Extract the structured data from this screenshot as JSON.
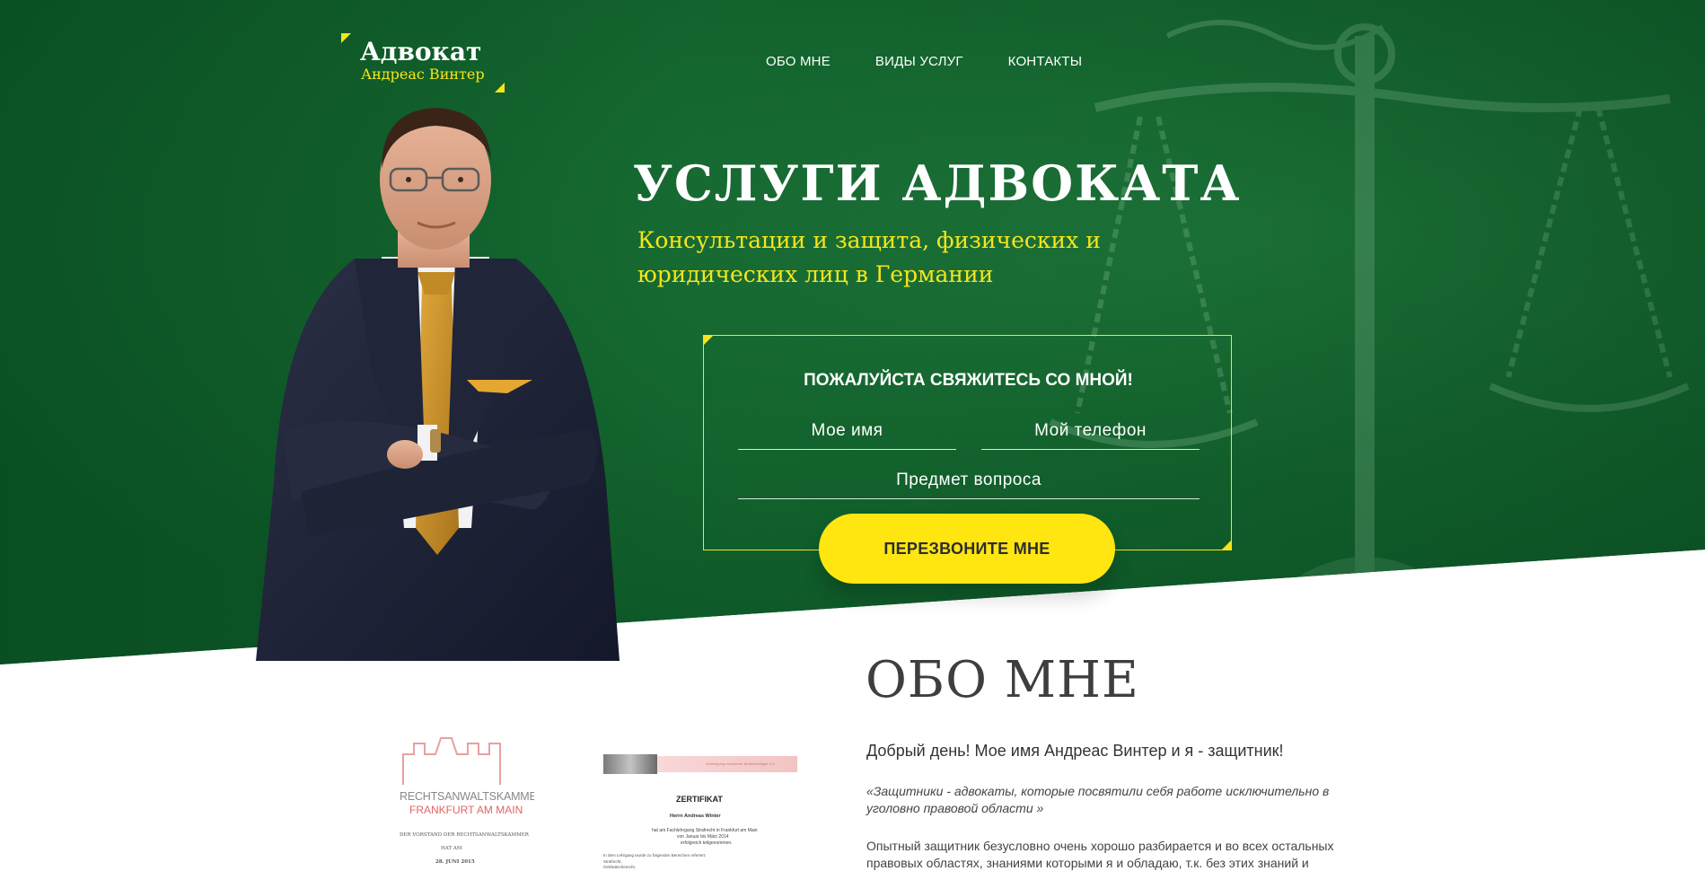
{
  "logo": {
    "title": "Адвокат",
    "subtitle": "Андреас Винтер"
  },
  "nav": {
    "items": [
      {
        "label": "ОБО МНЕ"
      },
      {
        "label": "ВИДЫ УСЛУГ"
      },
      {
        "label": "КОНТАКТЫ"
      }
    ]
  },
  "hero": {
    "title": "УСЛУГИ АДВОКАТА",
    "subtitle": "Консультации и защита, физических и юридических лиц в Германии"
  },
  "form": {
    "title": "ПОЖАЛУЙСТА СВЯЖИТЕСЬ СО МНОЙ!",
    "name_placeholder": "Мое имя",
    "phone_placeholder": "Мой телефон",
    "subject_placeholder": "Предмет вопроса",
    "submit_label": "ПЕРЕЗВОНИТЕ МНЕ"
  },
  "about": {
    "title": "ОБО МНЕ",
    "greeting": "Добрый день! Мое имя Андреас Винтер и я - защитник!",
    "quote": "«Защитники - адвокаты, которые посвятили себя работе исключительно в уголовно правовой области »",
    "text": "Опытный защитник безусловно очень хорошо разбирается и во всех остальных правовых областях, знаниями которыми я и обладаю, т.к. без этих знаний и наличии"
  },
  "certificates": {
    "cert1": {
      "line1": "RECHTSANWALTSKAMMER",
      "line2": "FRANKFURT AM MAIN",
      "line3": "DER VORSTAND DER RECHTSANWALTSKAMMER",
      "line4": "HAT AM",
      "line5": "28. JUNI 2015"
    },
    "cert2": {
      "header": "Vereinigung hessischer Strafverteidiger e.V.",
      "title": "ZERTIFIKAT",
      "name": "Herrn Andreas Winter",
      "line1": "hat am Fachlehrgang Strafrecht in Frankfurt am Main",
      "line2": "von Januar bis März 2014",
      "line3": "erfolgreich teilgenommen.",
      "line4": "In dem Lehrgang wurde zu folgenden Bereichen referiert:",
      "line5": "Strafrecht,",
      "line6": "Geldwäscherecht,"
    }
  },
  "colors": {
    "hero_green": "#0e5a28",
    "accent_yellow": "#f6e51c",
    "button_yellow": "#ffe611",
    "text_dark": "#3e3e3e"
  }
}
